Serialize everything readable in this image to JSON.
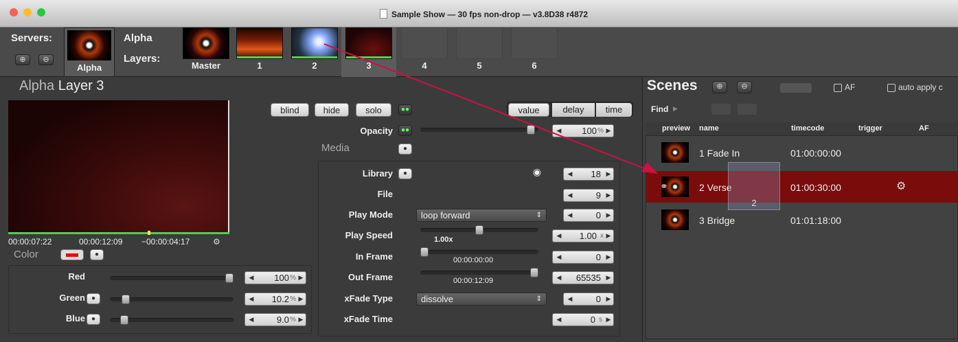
{
  "window": {
    "title": "Sample Show  —  30 fps non-drop  —  v3.8D38 r4872"
  },
  "servers": {
    "label": "Servers:",
    "selected_name": "Alpha",
    "server_label": "Alpha"
  },
  "layers": {
    "label": "Layers:",
    "tabs": [
      "Master",
      "1",
      "2",
      "3",
      "4",
      "5",
      "6"
    ],
    "selected": "3"
  },
  "layer_panel": {
    "server": "Alpha",
    "title": "Layer 3",
    "buttons": {
      "blind": "blind",
      "hide": "hide",
      "solo": "solo"
    },
    "modes": [
      "value",
      "delay",
      "time"
    ],
    "selected_mode": "value",
    "opacity": {
      "label": "Opacity",
      "value": "100",
      "unit": "%",
      "level": 0.97
    },
    "media_label": "Media",
    "timecodes": {
      "elapsed": "00:00:07:22",
      "duration": "00:00:12:09",
      "remaining": "−00:00:04:17"
    },
    "color": {
      "label": "Color",
      "swatch": "#e01010",
      "red": {
        "label": "Red",
        "value": "100",
        "unit": "%",
        "level": 1.0
      },
      "green": {
        "label": "Green",
        "value": "10.2",
        "unit": "%",
        "level": 0.1
      },
      "blue": {
        "label": "Blue",
        "value": "9.0",
        "unit": "%",
        "level": 0.09
      }
    },
    "media": {
      "library": {
        "label": "Library",
        "value": "18"
      },
      "file": {
        "label": "File",
        "value": "9"
      },
      "play_mode": {
        "label": "Play Mode",
        "selected": "loop forward",
        "value": "0"
      },
      "play_speed": {
        "label": "Play Speed",
        "display": "1.00x",
        "value": "1.00",
        "unit": "x",
        "level": 0.5
      },
      "in_frame": {
        "label": "In Frame",
        "display": "00:00:00:00",
        "value": "0",
        "level": 0.0
      },
      "out_frame": {
        "label": "Out Frame",
        "display": "00:00:12:09",
        "value": "65535",
        "level": 1.0
      },
      "xfade_type": {
        "label": "xFade Type",
        "selected": "dissolve",
        "value": "0"
      },
      "xfade_time": {
        "label": "xFade Time",
        "value": "0",
        "unit": "s"
      }
    }
  },
  "scenes": {
    "title": "Scenes",
    "af_label": "AF",
    "auto_apply_label": "auto apply c",
    "find_label": "Find",
    "columns": [
      "preview",
      "name",
      "timecode",
      "trigger",
      "AF"
    ],
    "rows": [
      {
        "name": "1 Fade In",
        "timecode": "01:00:00:00"
      },
      {
        "name": "2 Verse",
        "timecode": "01:00:30:00"
      },
      {
        "name": "3 Bridge",
        "timecode": "01:01:18:00"
      }
    ],
    "drag_label": "2"
  },
  "colors": {
    "accent": "#8a0e0e",
    "arrow": "#cc1144",
    "green": "#55cc55"
  }
}
